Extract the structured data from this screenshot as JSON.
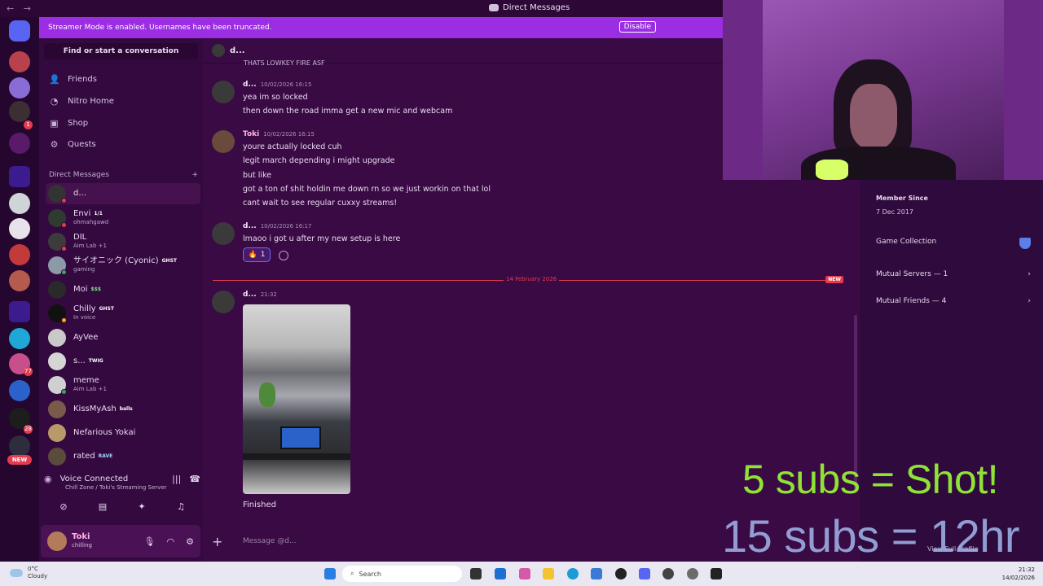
{
  "window": {
    "title": "Direct Messages"
  },
  "banner": {
    "message": "Streamer Mode is enabled. Usernames have been truncated.",
    "button": "Disable"
  },
  "rail": {
    "badges": [
      "1",
      "77",
      "28"
    ],
    "new_label": "NEW"
  },
  "sidebar": {
    "find_placeholder": "Find or start a conversation",
    "nav": [
      {
        "label": "Friends",
        "icon": "friends-icon"
      },
      {
        "label": "Nitro Home",
        "icon": "nitro-icon"
      },
      {
        "label": "Shop",
        "icon": "shop-icon"
      },
      {
        "label": "Quests",
        "icon": "quests-icon"
      }
    ],
    "dm_header": "Direct Messages",
    "dms": [
      {
        "name": "d...",
        "tag": "",
        "sub": ""
      },
      {
        "name": "Envi",
        "tag": "1/1",
        "sub": "ohmahgawd"
      },
      {
        "name": "DIL",
        "tag": "",
        "sub": "Aim Lab +1"
      },
      {
        "name": "サイオニック (Cyonic)",
        "tag": "GHST",
        "sub": "gaming"
      },
      {
        "name": "Moi",
        "tag": "$$$",
        "sub": ""
      },
      {
        "name": "Chilly",
        "tag": "GHST",
        "sub": "In voice"
      },
      {
        "name": "AyVee",
        "tag": "",
        "sub": ""
      },
      {
        "name": "s...",
        "tag": "TWIG",
        "sub": ""
      },
      {
        "name": "meme",
        "tag": "",
        "sub": "Aim Lab +1"
      },
      {
        "name": "KissMyAsh",
        "tag": "balls",
        "sub": ""
      },
      {
        "name": "Nefarious Yokai",
        "tag": "",
        "sub": ""
      },
      {
        "name": "rated",
        "tag": "RAVE",
        "sub": ""
      }
    ],
    "voice": {
      "status": "Voice Connected",
      "channel": "Chill Zone / Toki's Streaming Server"
    },
    "user": {
      "name": "Toki",
      "status": "chilling"
    }
  },
  "chat": {
    "header_name": "d...",
    "cutoff_text": "THATS LOWKEY FIRE ASF",
    "messages": [
      {
        "author": "d...",
        "time": "10/02/2026 16:15",
        "lines": [
          "yea im so locked",
          "then down the road imma get a new mic and webcam"
        ]
      },
      {
        "author": "Toki",
        "time": "10/02/2026 16:15",
        "lines": [
          "youre actually locked cuh",
          "legit march depending i might upgrade",
          "but like",
          "got a ton of shit holdin me down rn so we just workin on that lol",
          "cant wait to see regular cuxxy streams!"
        ]
      },
      {
        "author": "d...",
        "time": "10/02/2026 16:17",
        "lines": [
          "lmaoo i got u after my new setup is here"
        ]
      }
    ],
    "reaction": {
      "emoji": "🔥",
      "count": "1"
    },
    "divider_date": "14 February 2026",
    "new_label": "NEW",
    "last_message": {
      "author": "d...",
      "time": "21:32",
      "text": "Finished"
    },
    "composer_placeholder": "Message @d..."
  },
  "profile": {
    "member_since_label": "Member Since",
    "member_since_value": "7 Dec 2017",
    "game_collection": "Game Collection",
    "mutual_servers": "Mutual Servers — 1",
    "mutual_friends": "Mutual Friends — 4",
    "view_full_profile": "View Full Profile"
  },
  "overlay": {
    "line1": "5 subs = Shot!",
    "line2": "15 subs = 12hr"
  },
  "taskbar": {
    "weather_temp": "0°C",
    "weather_desc": "Cloudy",
    "search_label": "Search",
    "time": "21:32",
    "date": "14/02/2026"
  }
}
